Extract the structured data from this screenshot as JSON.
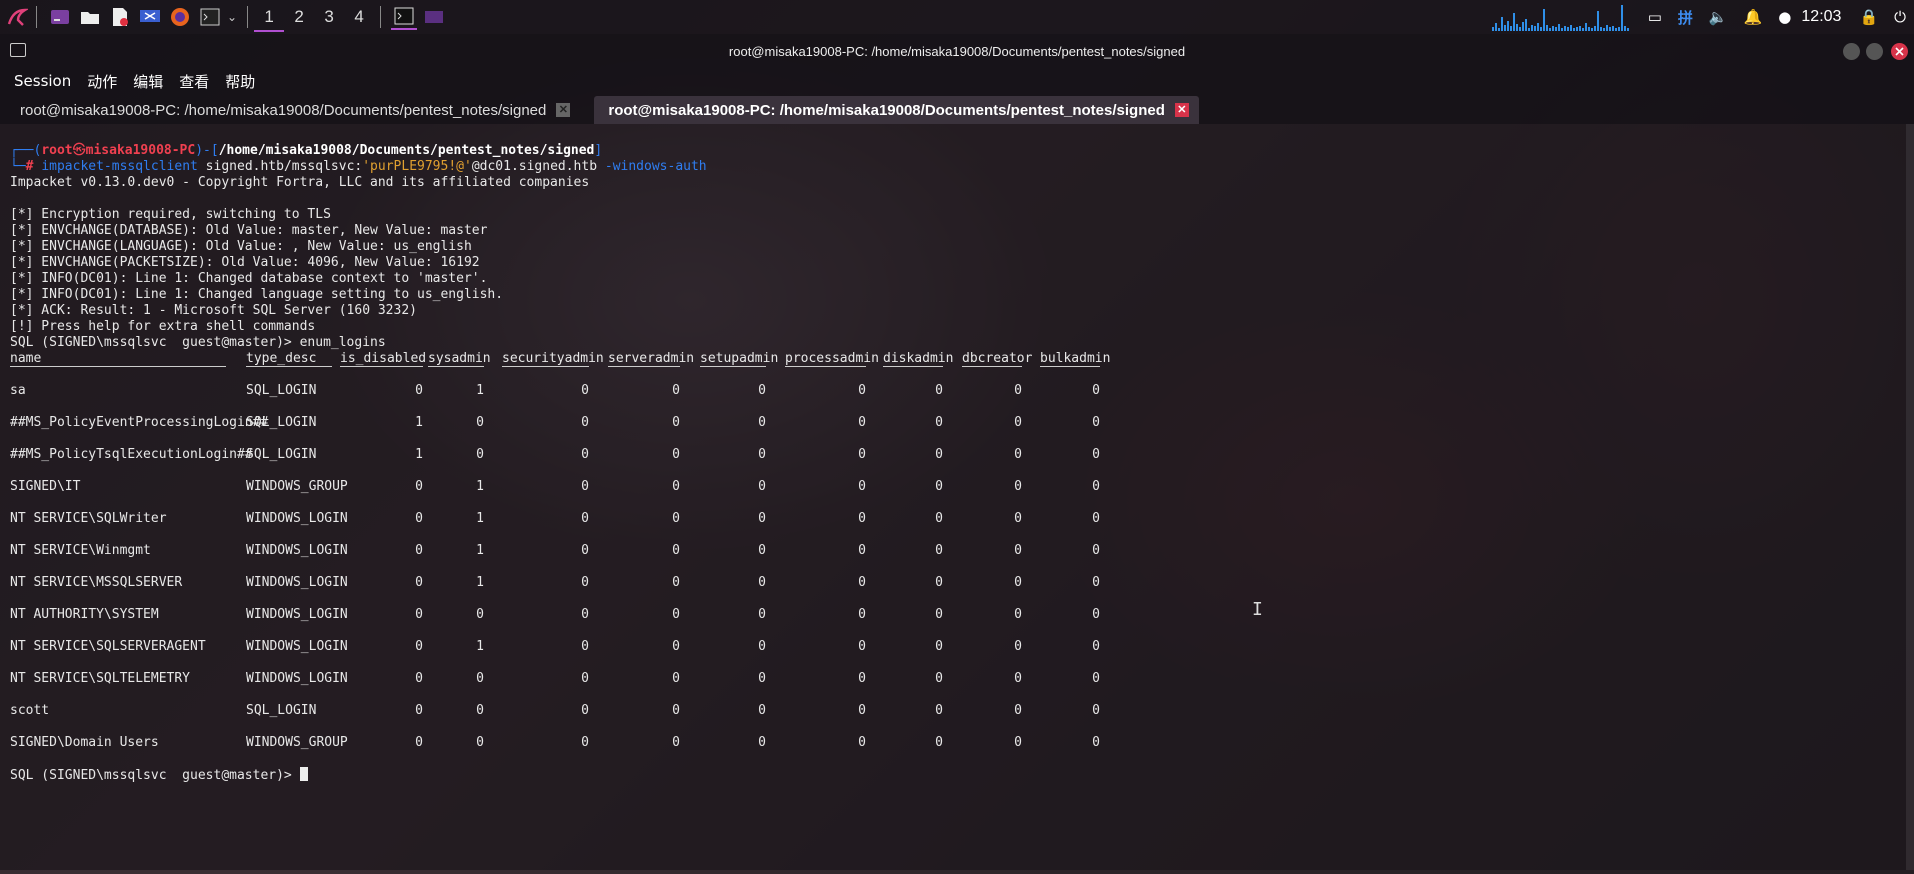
{
  "panel": {
    "workspaces": [
      "1",
      "2",
      "3",
      "4"
    ],
    "active_workspace": "1",
    "clock": "12:03",
    "tray_icons": [
      "network-graph-icon",
      "display-icon",
      "input-method-icon",
      "volume-icon",
      "notification-bell-icon",
      "updates-icon",
      "lock-icon",
      "power-icon"
    ],
    "input_method_label": "拼"
  },
  "window": {
    "title": "root@misaka19008-PC: /home/misaka19008/Documents/pentest_notes/signed"
  },
  "menubar": {
    "items": [
      "Session",
      "动作",
      "编辑",
      "查看",
      "帮助"
    ]
  },
  "tabs": [
    {
      "label": "root@misaka19008-PC: /home/misaka19008/Documents/pentest_notes/signed",
      "active": false
    },
    {
      "label": "root@misaka19008-PC: /home/misaka19008/Documents/pentest_notes/signed",
      "active": true
    }
  ],
  "terminal": {
    "prompt": {
      "frame_open": "┌──(",
      "user": "root",
      "at": "㉿",
      "host": "misaka19008-PC",
      "frame_mid": ")-[",
      "path": "/home/misaka19008/Documents/pentest_notes/signed",
      "frame_close": "]",
      "frame_bottom": "└─",
      "hash": "# ",
      "cmd_name": "impacket-mssqlclient",
      "cmd_arg1": " signed.htb/mssqlsvc:",
      "cmd_quoted": "'purPLE9795!@'",
      "cmd_arg2": "@dc01.signed.htb",
      "cmd_flag": " -windows-auth"
    },
    "output_lines": [
      "Impacket v0.13.0.dev0 - Copyright Fortra, LLC and its affiliated companies",
      "",
      "[*] Encryption required, switching to TLS",
      "[*] ENVCHANGE(DATABASE): Old Value: master, New Value: master",
      "[*] ENVCHANGE(LANGUAGE): Old Value: , New Value: us_english",
      "[*] ENVCHANGE(PACKETSIZE): Old Value: 4096, New Value: 16192",
      "[*] INFO(DC01): Line 1: Changed database context to 'master'.",
      "[*] INFO(DC01): Line 1: Changed language setting to us_english.",
      "[*] ACK: Result: 1 - Microsoft SQL Server (160 3232)",
      "[!] Press help for extra shell commands",
      "SQL (SIGNED\\mssqlsvc  guest@master)> enum_logins"
    ],
    "table": {
      "columns": [
        "name",
        "type_desc",
        "is_disabled",
        "sysadmin",
        "securityadmin",
        "serveradmin",
        "setupadmin",
        "processadmin",
        "diskadmin",
        "dbcreator",
        "bulkadmin"
      ],
      "rows": [
        [
          "sa",
          "SQL_LOGIN",
          "0",
          "1",
          "0",
          "0",
          "0",
          "0",
          "0",
          "0",
          "0"
        ],
        [
          "##MS_PolicyEventProcessingLogin##",
          "SQL_LOGIN",
          "1",
          "0",
          "0",
          "0",
          "0",
          "0",
          "0",
          "0",
          "0"
        ],
        [
          "##MS_PolicyTsqlExecutionLogin##",
          "SQL_LOGIN",
          "1",
          "0",
          "0",
          "0",
          "0",
          "0",
          "0",
          "0",
          "0"
        ],
        [
          "SIGNED\\IT",
          "WINDOWS_GROUP",
          "0",
          "1",
          "0",
          "0",
          "0",
          "0",
          "0",
          "0",
          "0"
        ],
        [
          "NT SERVICE\\SQLWriter",
          "WINDOWS_LOGIN",
          "0",
          "1",
          "0",
          "0",
          "0",
          "0",
          "0",
          "0",
          "0"
        ],
        [
          "NT SERVICE\\Winmgmt",
          "WINDOWS_LOGIN",
          "0",
          "1",
          "0",
          "0",
          "0",
          "0",
          "0",
          "0",
          "0"
        ],
        [
          "NT SERVICE\\MSSQLSERVER",
          "WINDOWS_LOGIN",
          "0",
          "1",
          "0",
          "0",
          "0",
          "0",
          "0",
          "0",
          "0"
        ],
        [
          "NT AUTHORITY\\SYSTEM",
          "WINDOWS_LOGIN",
          "0",
          "0",
          "0",
          "0",
          "0",
          "0",
          "0",
          "0",
          "0"
        ],
        [
          "NT SERVICE\\SQLSERVERAGENT",
          "WINDOWS_LOGIN",
          "0",
          "1",
          "0",
          "0",
          "0",
          "0",
          "0",
          "0",
          "0"
        ],
        [
          "NT SERVICE\\SQLTELEMETRY",
          "WINDOWS_LOGIN",
          "0",
          "0",
          "0",
          "0",
          "0",
          "0",
          "0",
          "0",
          "0"
        ],
        [
          "scott",
          "SQL_LOGIN",
          "0",
          "0",
          "0",
          "0",
          "0",
          "0",
          "0",
          "0",
          "0"
        ],
        [
          "SIGNED\\Domain Users",
          "WINDOWS_GROUP",
          "0",
          "0",
          "0",
          "0",
          "0",
          "0",
          "0",
          "0",
          "0"
        ]
      ]
    },
    "final_prompt": "SQL (SIGNED\\mssqlsvc  guest@master)> "
  }
}
